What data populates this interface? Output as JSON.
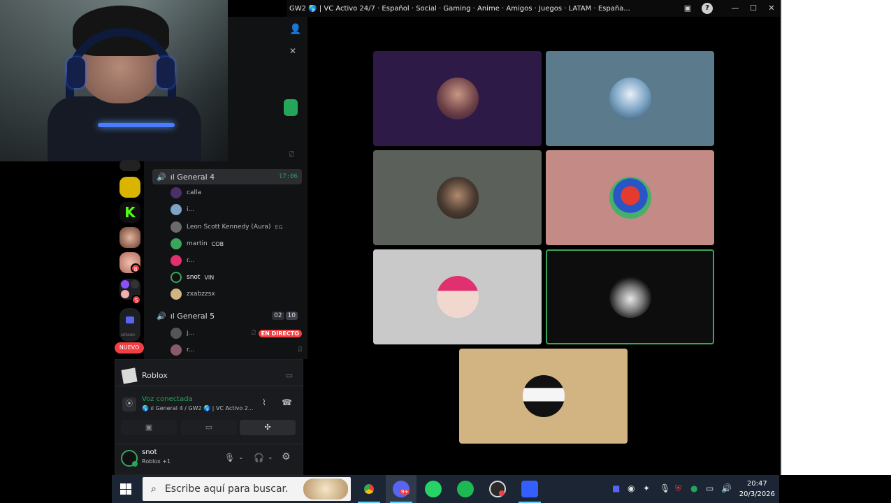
{
  "window": {
    "title": "GW2 🌎 | VC Activo 24/7 · Español · Social · Gaming · Anime · Amigos · Juegos · LATAM · España..."
  },
  "channels": {
    "general4": {
      "name": "ıl General 4",
      "time": "17:06"
    },
    "users4": [
      {
        "name": "calla",
        "tag": ""
      },
      {
        "name": "i...",
        "tag": ""
      },
      {
        "name": "Leon Scott Kennedy (Aura)",
        "tag": "EG"
      },
      {
        "name": "martin",
        "tag": "COB"
      },
      {
        "name": "r...",
        "tag": ""
      },
      {
        "name": "snot",
        "tag": "VIN"
      },
      {
        "name": "zxabzzsx",
        "tag": ""
      }
    ],
    "general5": {
      "name": "ıl General 5",
      "count_a": "02",
      "count_b": "10"
    },
    "users5": [
      {
        "name": "j...",
        "live": "EN DIRECTO"
      },
      {
        "name": "r...",
        "live": ""
      }
    ]
  },
  "servers": {
    "badge1": "8",
    "badge2": "5",
    "new_label": "NUEVO",
    "folder_label": "ULTRAREA"
  },
  "activity": {
    "game": "Roblox"
  },
  "voice": {
    "status": "Voz conectada",
    "location": "🌎 ıl General 4 / GW2 🌎 | VC Activo 2..."
  },
  "user": {
    "name": "snot",
    "status": "Roblox +1"
  },
  "taskbar": {
    "search_placeholder": "Escribe aquí para buscar.",
    "discord_badge": "9+",
    "time": "20:47",
    "date": "20/3/2026"
  },
  "colors": {
    "tile1": "#2e1a47",
    "tile2": "#5b7a8c",
    "tile3": "#5b605b",
    "tile4": "#c48a85",
    "tile5": "#c9c9c9",
    "tile6": "#0d0d0d",
    "tile7": "#d2b483",
    "speaking": "#3ba55d",
    "live": "#f23f43"
  }
}
